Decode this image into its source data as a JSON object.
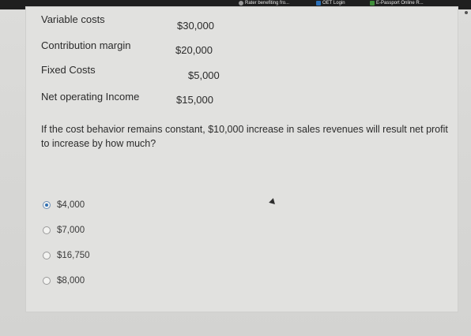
{
  "browser": {
    "bookmarks": [
      {
        "label": "Rater benefiting fro...",
        "icon": "globe-icon"
      },
      {
        "label": "OET Login",
        "icon": "oet-icon"
      },
      {
        "label": "E-Passport Online R...",
        "icon": "bookmark-icon"
      }
    ]
  },
  "statement": {
    "rows": [
      {
        "label": "Variable costs",
        "value": "$30,000"
      },
      {
        "label": "Contribution margin",
        "value": "$20,000"
      },
      {
        "label": "Fixed Costs",
        "value": "$5,000"
      },
      {
        "label": "Net operating Income",
        "value": "$15,000"
      }
    ]
  },
  "question": {
    "text": "If the cost behavior remains constant, $10,000 increase in sales revenues will result net profit to increase by how much?"
  },
  "options": [
    {
      "label": "$4,000",
      "selected": true
    },
    {
      "label": "$7,000",
      "selected": false
    },
    {
      "label": "$16,750",
      "selected": false
    },
    {
      "label": "$8,000",
      "selected": false
    }
  ],
  "colors": {
    "selected_radio": "#2f6fb3",
    "text": "#2b2b2b"
  }
}
